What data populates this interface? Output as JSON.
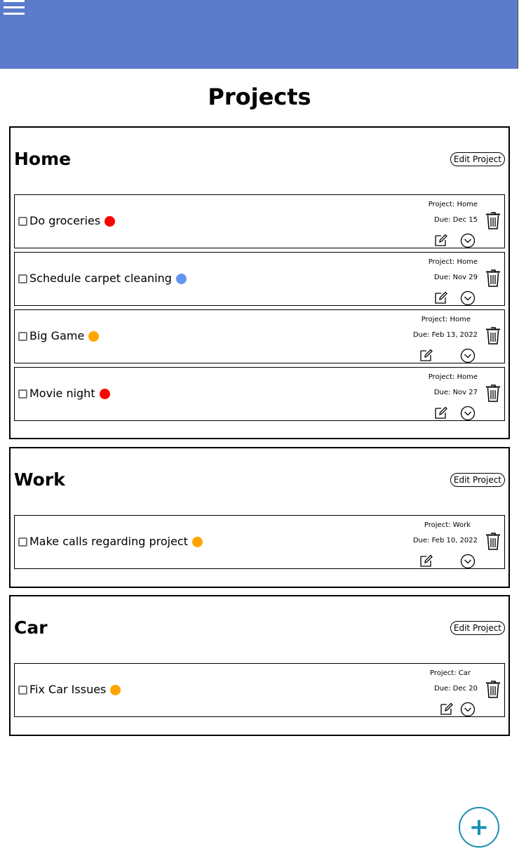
{
  "page": {
    "title": "Projects"
  },
  "colors": {
    "header": "#5b7bcb",
    "high": "#ff0000",
    "medium": "#ffa500",
    "low": "#6495ed",
    "fab": "#1a8fb0"
  },
  "icons": {
    "menu": "hamburger-menu-icon",
    "edit": "pencil-square-icon",
    "expand": "chevron-down-circle-icon",
    "delete": "trash-icon",
    "add": "plus-icon"
  },
  "edit_project_label": "Edit Project",
  "projects": [
    {
      "name": "Home",
      "tasks": [
        {
          "title": "Do groceries",
          "priority": "high",
          "project_label": "Project: Home",
          "due_label": "Due: Dec 15"
        },
        {
          "title": "Schedule carpet cleaning",
          "priority": "low",
          "project_label": "Project: Home",
          "due_label": "Due: Nov 29"
        },
        {
          "title": "Big Game",
          "priority": "medium",
          "project_label": "Project: Home",
          "due_label": "Due: Feb 13, 2022"
        },
        {
          "title": "Movie night",
          "priority": "high",
          "project_label": "Project: Home",
          "due_label": "Due: Nov 27"
        }
      ]
    },
    {
      "name": "Work",
      "tasks": [
        {
          "title": "Make calls regarding project",
          "priority": "medium",
          "project_label": "Project: Work",
          "due_label": "Due: Feb 10, 2022"
        }
      ]
    },
    {
      "name": "Car",
      "tasks": [
        {
          "title": "Fix Car Issues",
          "priority": "medium",
          "project_label": "Project: Car",
          "due_label": "Due: Dec 20"
        }
      ]
    }
  ],
  "fab": {
    "label": "+"
  }
}
